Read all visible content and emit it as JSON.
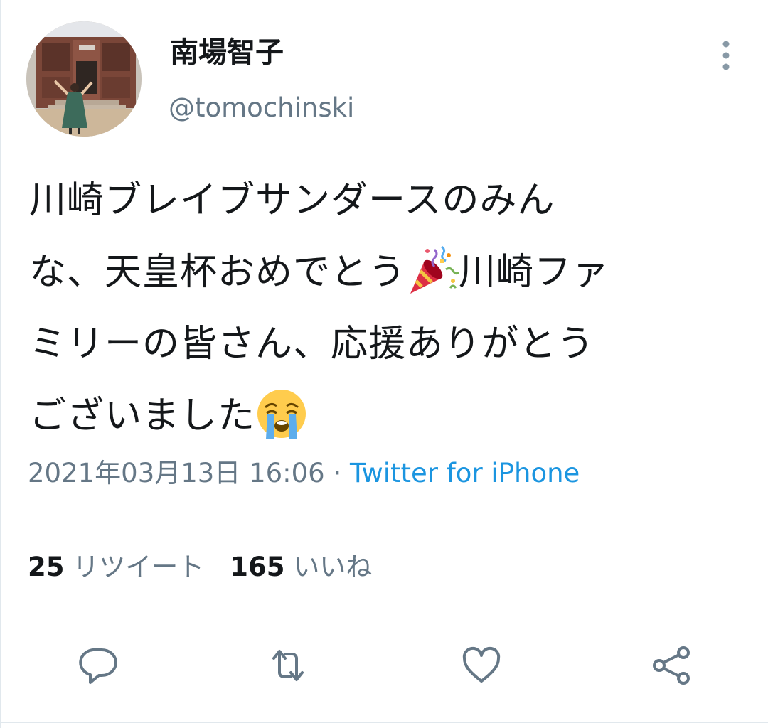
{
  "user": {
    "display_name": "南場智子",
    "handle": "@tomochinski"
  },
  "tweet": {
    "line1": "川崎ブレイブサンダースのみん",
    "line2_a": "な、天皇杯おめでとう",
    "line2_b": "川崎ファ",
    "line3": "ミリーの皆さん、応援ありがとう",
    "line4": "ございました",
    "emojis": [
      "party-popper",
      "loudly-crying-face"
    ]
  },
  "meta": {
    "timestamp": "2021年03月13日 16:06",
    "separator": " · ",
    "source": "Twitter for iPhone"
  },
  "stats": {
    "retweets_count": "25",
    "retweets_label": "リツイート",
    "likes_count": "165",
    "likes_label": "いいね"
  },
  "actions": [
    "reply-icon",
    "retweet-icon",
    "like-icon",
    "share-icon"
  ],
  "colors": {
    "text": "#14171a",
    "secondary": "#657786",
    "link": "#1b95e0",
    "divider": "#e1e8ed"
  }
}
